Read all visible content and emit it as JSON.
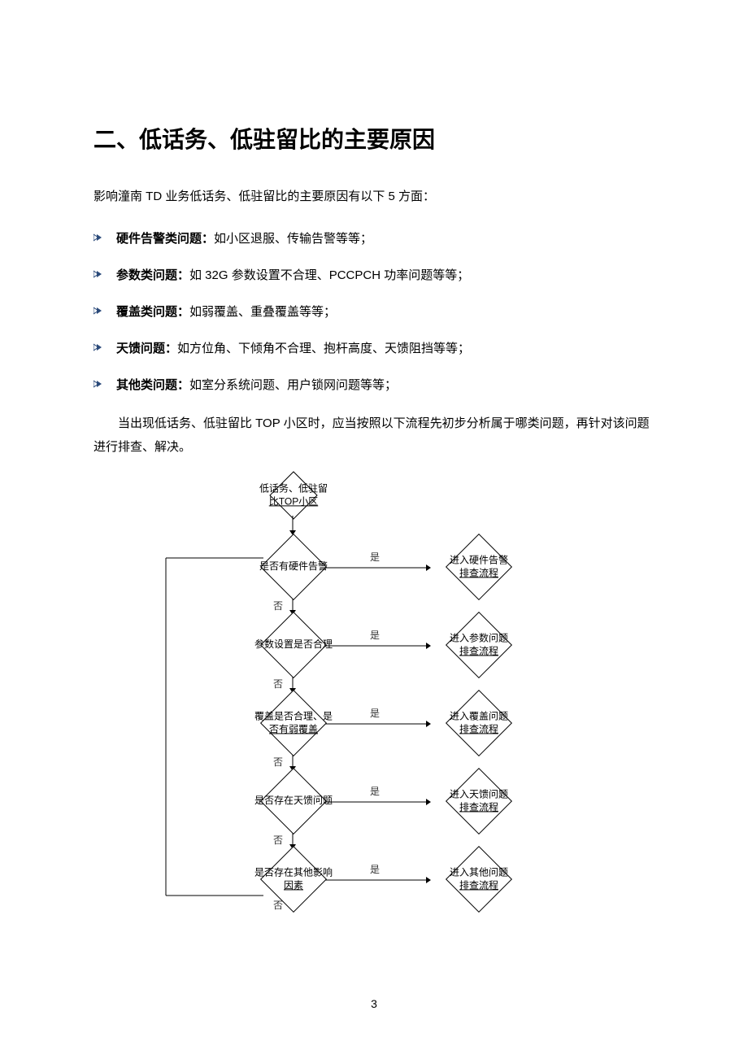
{
  "title": "二、低话务、低驻留比的主要原因",
  "intro": "影响潼南 TD 业务低话务、低驻留比的主要原因有以下 5 方面：",
  "bullets": [
    {
      "label": "硬件告警类问题：",
      "text": "如小区退服、传输告警等等；"
    },
    {
      "label": "参数类问题：",
      "text": "如 32G 参数设置不合理、PCCPCH 功率问题等等；"
    },
    {
      "label": "覆盖类问题：",
      "text": "如弱覆盖、重叠覆盖等等；"
    },
    {
      "label": "天馈问题：",
      "text": "如方位角、下倾角不合理、抱杆高度、天馈阻挡等等；"
    },
    {
      "label": "其他类问题：",
      "text": "如室分系统问题、用户锁网问题等等；"
    }
  ],
  "para": "当出现低话务、低驻留比 TOP 小区时，应当按照以下流程先初步分析属于哪类问题，再针对该问题进行排查、解决。",
  "flow": {
    "start": {
      "l1": "低话务、低驻留",
      "l2": "比TOP小区"
    },
    "steps": [
      {
        "q": "是否有硬件告警",
        "a1": "进入硬件告警",
        "a2": "排查流程"
      },
      {
        "q": "参数设置是否合理",
        "a1": "进入参数问题",
        "a2": "排查流程"
      },
      {
        "q1": "覆盖是否合理、是",
        "q2": "否有弱覆盖",
        "a1": "进入覆盖问题",
        "a2": "排查流程"
      },
      {
        "q": "是否存在天馈问题",
        "a1": "进入天馈问题",
        "a2": "排查流程"
      },
      {
        "q1": "是否存在其他影响",
        "q2": "因素",
        "a1": "进入其他问题",
        "a2": "排查流程"
      }
    ],
    "yes": "是",
    "no": "否"
  },
  "pagenum": "3"
}
